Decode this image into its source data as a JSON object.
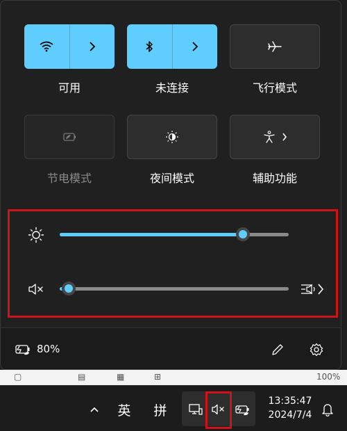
{
  "quick_settings": {
    "tiles": [
      {
        "label": "可用",
        "icon": "wifi-icon",
        "state": "active",
        "has_expand": true
      },
      {
        "label": "未连接",
        "icon": "bluetooth-icon",
        "state": "active",
        "has_expand": true
      },
      {
        "label": "飞行模式",
        "icon": "airplane-icon",
        "state": "inactive",
        "has_expand": false
      },
      {
        "label": "节电模式",
        "icon": "battery-saver-icon",
        "state": "disabled",
        "has_expand": false
      },
      {
        "label": "夜间模式",
        "icon": "night-light-icon",
        "state": "inactive",
        "has_expand": false
      },
      {
        "label": "辅助功能",
        "icon": "accessibility-icon",
        "state": "inactive",
        "has_expand": true
      }
    ],
    "brightness": {
      "icon": "brightness-icon",
      "level": 0.8
    },
    "volume": {
      "icon": "volume-muted-icon",
      "level": 0.04,
      "audio_output_icon": "audio-output-icon"
    },
    "footer": {
      "battery_text": "80%",
      "battery_icon": "battery-charging-icon",
      "edit_icon": "pencil-icon",
      "settings_icon": "gear-icon"
    }
  },
  "background_app": {
    "zoom_text": "100%"
  },
  "taskbar": {
    "chevron": "^",
    "ime_lang": "英",
    "ime_mode": "拼",
    "time": "13:35:47",
    "date": "2024/7/4"
  },
  "colors": {
    "accent": "#60cdff",
    "highlight": "#d0121b",
    "panel_bg": "#202020"
  }
}
